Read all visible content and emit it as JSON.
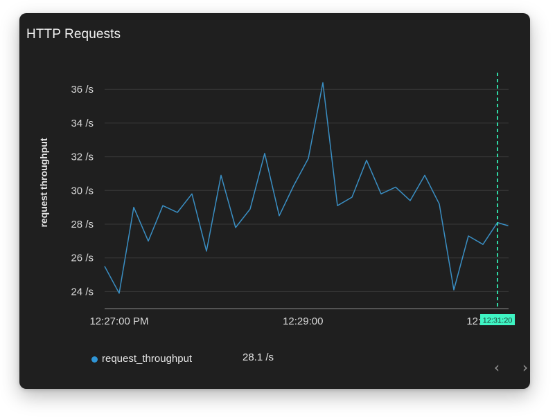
{
  "panel": {
    "title": "HTTP Requests"
  },
  "chart_data": {
    "type": "line",
    "ylabel": "request throughput",
    "y_unit_suffix": " /s",
    "ylim": [
      23.5,
      37
    ],
    "yticks": [
      24,
      26,
      28,
      30,
      32,
      34,
      36
    ],
    "y_tick_labels": [
      "24 /s",
      "26 /s",
      "28 /s",
      "30 /s",
      "32 /s",
      "34 /s",
      "36 /s"
    ],
    "x_tick_labels": [
      "12:27:00 PM",
      "12:29:00",
      "12:31:00"
    ],
    "x_tick_times_sec": [
      0,
      120,
      240
    ],
    "xlim_sec": [
      -9.5,
      254
    ],
    "grid": true,
    "series": [
      {
        "name": "request_throughput",
        "color": "#3a8fc4",
        "points": [
          [
            -9.5,
            25.5
          ],
          [
            0,
            23.9
          ],
          [
            9.5,
            29.0
          ],
          [
            19,
            27.0
          ],
          [
            28.5,
            29.1
          ],
          [
            38,
            28.7
          ],
          [
            47.5,
            29.8
          ],
          [
            57,
            26.4
          ],
          [
            66.5,
            30.9
          ],
          [
            76,
            27.8
          ],
          [
            85.5,
            28.9
          ],
          [
            95,
            32.2
          ],
          [
            104.5,
            28.5
          ],
          [
            114,
            30.3
          ],
          [
            123.5,
            31.9
          ],
          [
            133,
            36.4
          ],
          [
            142.5,
            29.1
          ],
          [
            152,
            29.6
          ],
          [
            161.5,
            31.8
          ],
          [
            171,
            29.8
          ],
          [
            180.5,
            30.2
          ],
          [
            190,
            29.4
          ],
          [
            199.5,
            30.9
          ],
          [
            209,
            29.2
          ],
          [
            218.5,
            24.1
          ],
          [
            228,
            27.3
          ],
          [
            237.5,
            26.8
          ],
          [
            247,
            28.1
          ],
          [
            254,
            27.9
          ]
        ]
      }
    ],
    "cursor": {
      "time_sec": 247,
      "label": "12:31:20",
      "color": "#2fd9a6"
    }
  },
  "legend": {
    "series_name": "request_throughput",
    "current_value": "28.1 /s",
    "dot_color": "#2f95d6"
  },
  "nav": {
    "prev_label": "‹",
    "next_label": "›"
  }
}
